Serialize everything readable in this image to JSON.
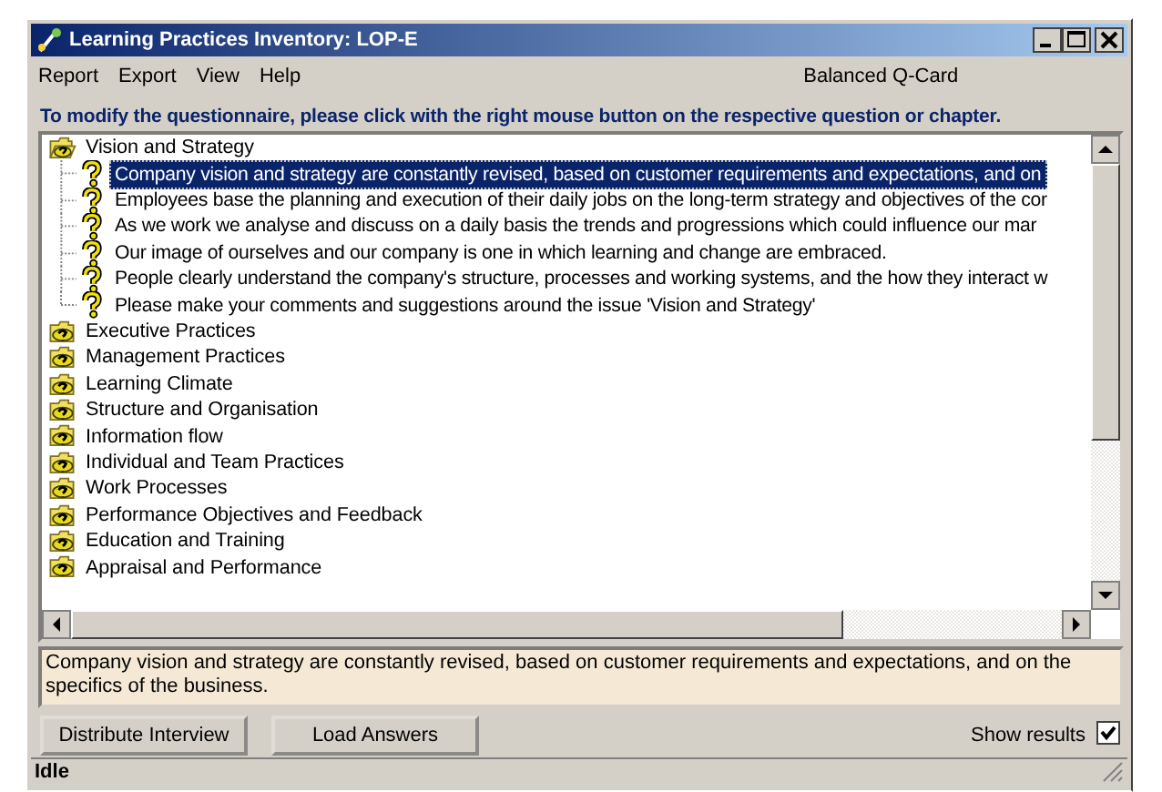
{
  "window": {
    "title": "Learning Practices Inventory: LOP-E"
  },
  "menu": [
    {
      "label": "Report"
    },
    {
      "label": "Export"
    },
    {
      "label": "View"
    },
    {
      "label": "Help"
    }
  ],
  "card_label": "Balanced Q-Card",
  "instruction": "To modify the questionnaire, please click with the right mouse button on the respective question or chapter.",
  "tree": [
    {
      "label": "Vision and Strategy",
      "expanded": true,
      "children": [
        {
          "label": "Company vision and strategy are constantly revised, based on customer requirements and expectations, and on",
          "selected": true
        },
        {
          "label": "Employees base the planning and execution of their daily jobs on the long-term strategy and objectives of the cor",
          "selected": false
        },
        {
          "label": "As we work we analyse and discuss on a daily basis the trends and progressions which could influence our mar",
          "selected": false
        },
        {
          "label": "Our image of ourselves and our company is one in which learning and change are embraced.",
          "selected": false
        },
        {
          "label": "People clearly understand the company's structure, processes and working systems, and the how they interact w",
          "selected": false
        },
        {
          "label": "Please make your comments and suggestions around the issue 'Vision and Strategy'",
          "selected": false
        }
      ]
    },
    {
      "label": "Executive Practices",
      "expanded": false
    },
    {
      "label": "Management Practices",
      "expanded": false
    },
    {
      "label": "Learning Climate",
      "expanded": false
    },
    {
      "label": "Structure and Organisation",
      "expanded": false
    },
    {
      "label": "Information flow",
      "expanded": false
    },
    {
      "label": "Individual and Team Practices",
      "expanded": false
    },
    {
      "label": "Work Processes",
      "expanded": false
    },
    {
      "label": "Performance Objectives and Feedback",
      "expanded": false
    },
    {
      "label": "Education and Training",
      "expanded": false
    },
    {
      "label": "Appraisal and Performance",
      "expanded": false
    }
  ],
  "description": "Company vision and strategy are constantly revised, based on customer requirements and expectations, and on the specifics of the business.",
  "buttons": [
    {
      "label": "Distribute Interview"
    },
    {
      "label": "Load Answers"
    }
  ],
  "show_results": {
    "label": "Show results",
    "checked": true
  },
  "status_bar": "Idle"
}
